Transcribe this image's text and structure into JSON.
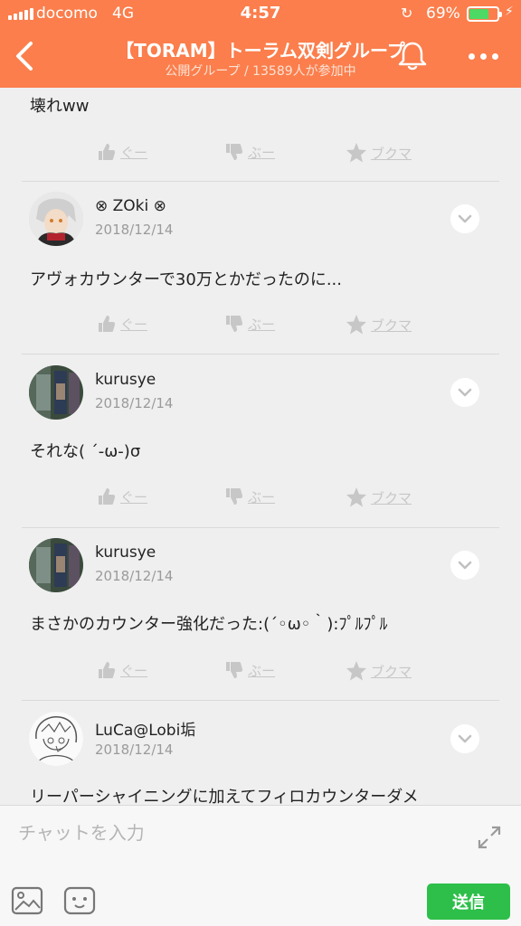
{
  "status": {
    "carrier": "docomo",
    "network": "4G",
    "time": "4:57",
    "battery_percent": "69%",
    "battery_level": 0.69,
    "battery_color": "#4cd964"
  },
  "nav": {
    "title": "【TORAM】トーラム双剣グループ",
    "subtitle": "公開グループ / 13589人が参加中",
    "accent_color": "#fb7e4c"
  },
  "reaction_labels": {
    "good": "ぐー",
    "boo": "ぶー",
    "bookmark": "ブクマ"
  },
  "feed": {
    "first_message": "壊れww",
    "posts": [
      {
        "user": "⊗ ZOki ⊗",
        "date": "2018/12/14",
        "text": "アヴォカウンターで30万とかだったのに..."
      },
      {
        "user": "kurusye",
        "date": "2018/12/14",
        "text": "それな( ´-ω-)σ"
      },
      {
        "user": "kurusye",
        "date": "2018/12/14",
        "text": "まさかのカウンター強化だった:(´◦ω◦｀):ﾌﾟﾙﾌﾟﾙ"
      },
      {
        "user": "LuCa@Lobi垢",
        "date": "2018/12/14",
        "text": "リーパーシャイニングに加えてフィロカウンターダメ"
      }
    ]
  },
  "composer": {
    "placeholder": "チャットを入力",
    "send_label": "送信",
    "send_color": "#2dbf4a"
  }
}
